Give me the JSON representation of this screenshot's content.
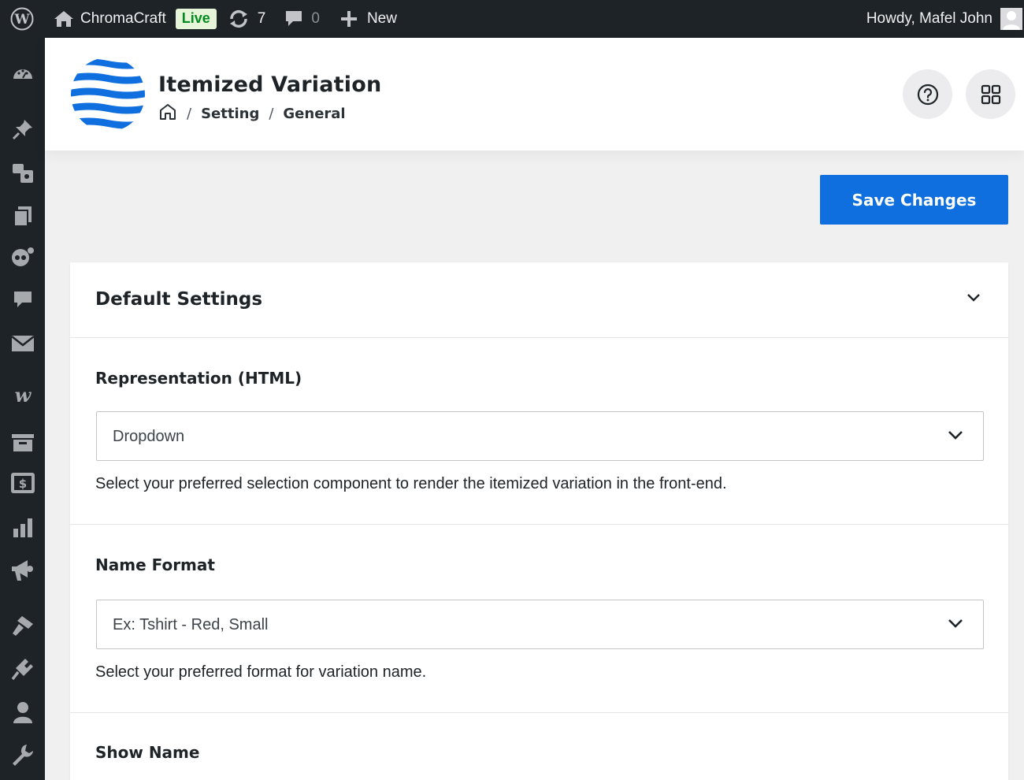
{
  "adminbar": {
    "site_name": "ChromaCraft",
    "live_badge": "Live",
    "updates_count": "7",
    "comments_count": "0",
    "new_label": "New",
    "howdy": "Howdy, Mafel John"
  },
  "sidebar": {
    "icons": [
      "dashboard-icon",
      "pin-icon",
      "media-icon",
      "pages-icon",
      "custom-icon",
      "comments-icon",
      "mail-icon",
      "woocommerce-icon",
      "archive-icon",
      "payments-icon",
      "analytics-icon",
      "marketing-icon",
      "appearance-icon",
      "plugins-icon",
      "users-icon",
      "tools-icon"
    ]
  },
  "header": {
    "title": "Itemized Variation",
    "breadcrumb": [
      "Setting",
      "General"
    ],
    "breadcrumb_sep": "/"
  },
  "actions": {
    "save_label": "Save Changes"
  },
  "panel": {
    "title": "Default Settings",
    "fields": [
      {
        "label": "Representation (HTML)",
        "value": "Dropdown",
        "help": "Select your preferred selection component to render the itemized variation in the front-end."
      },
      {
        "label": "Name Format",
        "value": "Ex: Tshirt - Red, Small",
        "help": "Select your preferred format for variation name."
      },
      {
        "label": "Show Name"
      }
    ]
  },
  "colors": {
    "adminbar": "#1d2327",
    "accent": "#0f6fde",
    "live_badge_bg": "#e6f4d7",
    "live_badge_text": "#008a20"
  }
}
